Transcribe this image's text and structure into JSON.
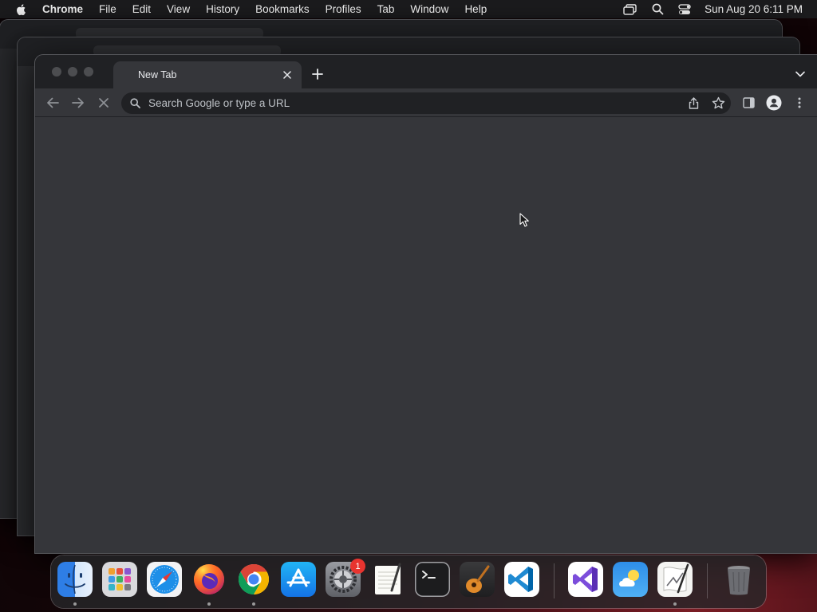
{
  "menubar": {
    "app_name": "Chrome",
    "items": [
      "File",
      "Edit",
      "View",
      "History",
      "Bookmarks",
      "Profiles",
      "Tab",
      "Window",
      "Help"
    ],
    "clock": "Sun Aug 20  6:11 PM"
  },
  "browser": {
    "tab_title": "New Tab",
    "omnibox_placeholder": "Search Google or type a URL",
    "theme": {
      "frame": "#202124",
      "toolbar": "#35363a",
      "omnibox": "#202124"
    }
  },
  "dock": {
    "apps": [
      {
        "name": "Finder",
        "icon": "finder-icon",
        "running": true
      },
      {
        "name": "Launchpad",
        "icon": "launchpad-icon",
        "running": false
      },
      {
        "name": "Safari",
        "icon": "safari-icon",
        "running": false
      },
      {
        "name": "Firefox",
        "icon": "firefox-icon",
        "running": true
      },
      {
        "name": "Chrome",
        "icon": "chrome-icon",
        "running": true
      },
      {
        "name": "App Store",
        "icon": "app-store-icon",
        "running": false
      },
      {
        "name": "System Settings",
        "icon": "system-settings-icon",
        "running": false,
        "badge": "1"
      },
      {
        "name": "TextEdit",
        "icon": "textedit-icon",
        "running": false
      },
      {
        "name": "Terminal",
        "icon": "terminal-icon",
        "running": false
      },
      {
        "name": "GarageBand",
        "icon": "garageband-icon",
        "running": false
      },
      {
        "name": "Visual Studio Code",
        "icon": "vscode-icon",
        "running": false
      },
      {
        "name": "Visual Studio",
        "icon": "visual-studio-icon",
        "running": false
      },
      {
        "name": "Weather",
        "icon": "weather-icon",
        "running": false
      },
      {
        "name": "Script Editor",
        "icon": "script-editor-icon",
        "running": true
      },
      {
        "name": "Trash",
        "icon": "trash-icon",
        "running": false
      }
    ],
    "badge_text": "1"
  }
}
